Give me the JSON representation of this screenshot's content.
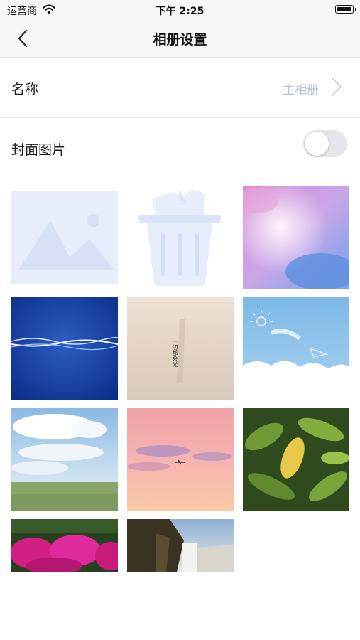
{
  "status_bar": {
    "carrier": "运营商",
    "time": "下午 2:25",
    "icons": [
      "wifi-icon",
      "battery-icon"
    ]
  },
  "nav": {
    "title": "相册设置",
    "back_icon": "chevron-left-icon"
  },
  "settings": {
    "name": {
      "label": "名称",
      "value": "主相册",
      "icon": "chevron-right-icon"
    },
    "cover": {
      "label": "封面图片",
      "toggle_on": false
    }
  },
  "gallery": {
    "tiles": [
      {
        "name": "add-image-placeholder",
        "icon": "image-placeholder-icon"
      },
      {
        "name": "delete-tile",
        "icon": "trash-icon"
      },
      {
        "name": "cover-option-pink-clouds"
      },
      {
        "name": "cover-option-blue-wave"
      },
      {
        "name": "cover-option-beige-text",
        "text": "一切都会光"
      },
      {
        "name": "cover-option-sky-doodle"
      },
      {
        "name": "cover-option-meadow"
      },
      {
        "name": "cover-option-pink-sunset"
      },
      {
        "name": "cover-option-green-leaves"
      },
      {
        "name": "cover-option-pink-flowers"
      },
      {
        "name": "cover-option-waterfall"
      }
    ]
  },
  "colors": {
    "accent_light": "#b7bfd6",
    "placeholder": "#e8edfb",
    "toggle_off": "#e6e6ea"
  }
}
